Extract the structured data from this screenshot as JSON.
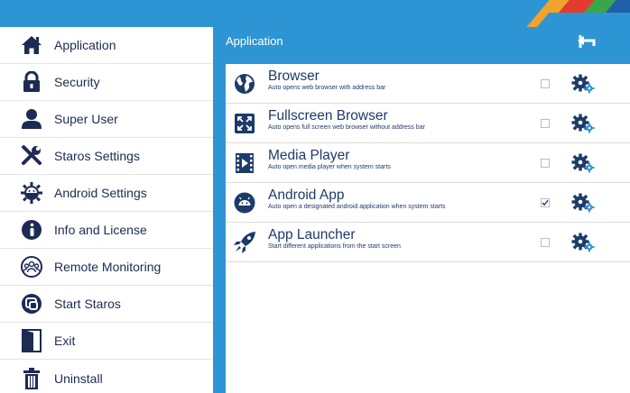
{
  "colors": {
    "accent": "#2d95d3",
    "navy": "#1c2b52",
    "gear_blue": "#2d95d3"
  },
  "sidebar": {
    "items": [
      {
        "label": "Application",
        "icon": "home-icon"
      },
      {
        "label": "Security",
        "icon": "lock-icon"
      },
      {
        "label": "Super User",
        "icon": "user-icon"
      },
      {
        "label": "Staros Settings",
        "icon": "tools-icon"
      },
      {
        "label": "Android Settings",
        "icon": "android-icon"
      },
      {
        "label": "Info and License",
        "icon": "info-icon"
      },
      {
        "label": "Remote Monitoring",
        "icon": "group-icon"
      },
      {
        "label": "Start Staros",
        "icon": "start-icon"
      },
      {
        "label": "Exit",
        "icon": "door-icon"
      },
      {
        "label": "Uninstall",
        "icon": "trash-icon"
      }
    ]
  },
  "main": {
    "title": "Application",
    "back_icon": "back-arrow-icon",
    "apps": [
      {
        "name": "Browser",
        "description": "Auto opens web browser with address bar",
        "checked": false,
        "icon": "globe-icon"
      },
      {
        "name": "Fullscreen Browser",
        "description": "Auto opens full screen web browser without address bar",
        "checked": false,
        "icon": "fullscreen-icon"
      },
      {
        "name": "Media Player",
        "description": "Auto open media player when system starts",
        "checked": false,
        "icon": "film-icon"
      },
      {
        "name": "Android App",
        "description": "Auto open a designated android application when system starts",
        "checked": true,
        "icon": "android-app-icon"
      },
      {
        "name": "App Launcher",
        "description": "Start different applications from the start screen",
        "checked": false,
        "icon": "rocket-icon"
      }
    ]
  }
}
